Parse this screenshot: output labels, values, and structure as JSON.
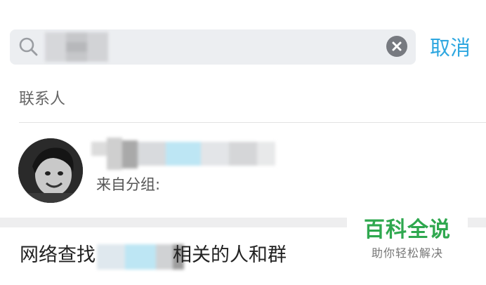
{
  "search": {
    "value": "",
    "cancel_label": "取消"
  },
  "contacts_section": {
    "label": "联系人",
    "contact": {
      "group_label": "来自分组:"
    }
  },
  "net_search": {
    "prefix": "网络查找",
    "suffix": "相关的人和群"
  },
  "watermark": {
    "title": "百科全说",
    "subtitle": "助你轻松解决"
  },
  "colors": {
    "accent": "#2ea7e0",
    "watermark_green": "#2fa84f"
  }
}
